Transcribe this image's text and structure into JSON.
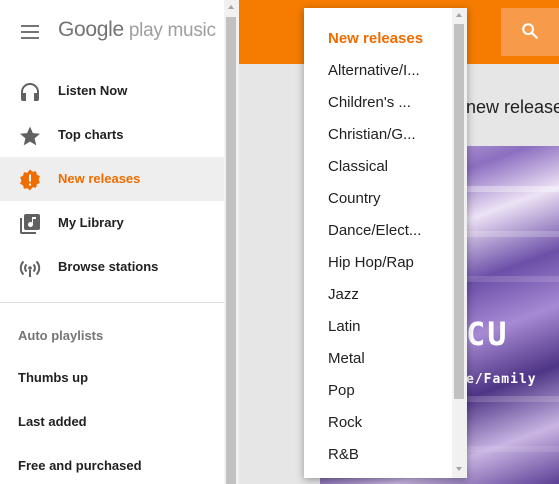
{
  "app": {
    "logo_google": "Google",
    "logo_product": " play music"
  },
  "sidebar": {
    "items": [
      {
        "label": "Listen Now",
        "icon": "headphones-icon"
      },
      {
        "label": "Top charts",
        "icon": "star-icon"
      },
      {
        "label": "New releases",
        "icon": "new-releases-icon",
        "active": true
      },
      {
        "label": "My Library",
        "icon": "library-icon"
      },
      {
        "label": "Browse stations",
        "icon": "radio-icon"
      }
    ],
    "section_title": "Auto playlists",
    "playlists": [
      "Thumbs up",
      "Last added",
      "Free and purchased"
    ]
  },
  "main": {
    "heading": "new release",
    "cover_text": "CU",
    "cover_sub": "e/Family"
  },
  "genre_dropdown": {
    "selected": "New releases",
    "options": [
      "Alternative/I...",
      "Children's ...",
      "Christian/G...",
      "Classical",
      "Country",
      "Dance/Elect...",
      "Hip Hop/Rap",
      "Jazz",
      "Latin",
      "Metal",
      "Pop",
      "Rock",
      "R&B"
    ]
  },
  "colors": {
    "accent": "#f57c00",
    "active_text": "#ef6c00",
    "active_bg": "#eeeeee"
  }
}
